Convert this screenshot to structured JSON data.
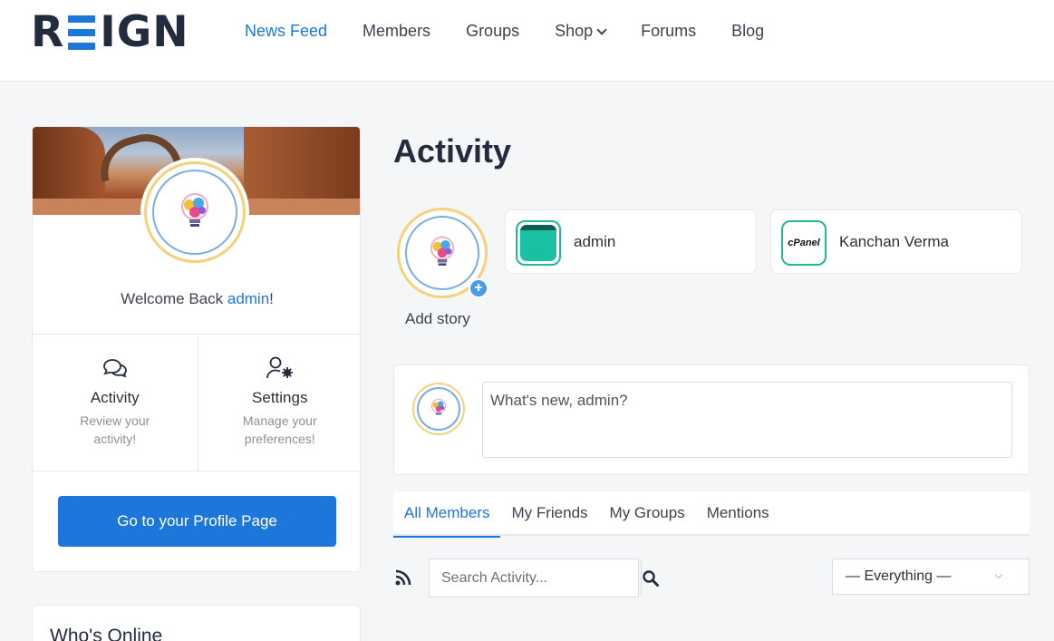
{
  "header": {
    "logo": {
      "left": "R",
      "right": "IGN"
    },
    "nav": [
      {
        "label": "News Feed",
        "active": true
      },
      {
        "label": "Members"
      },
      {
        "label": "Groups"
      },
      {
        "label": "Shop",
        "dropdown": true
      },
      {
        "label": "Forums"
      },
      {
        "label": "Blog"
      }
    ]
  },
  "profile_card": {
    "welcome_prefix": "Welcome Back ",
    "username": "admin",
    "welcome_suffix": "!",
    "shortcuts": [
      {
        "title": "Activity",
        "desc": "Review your activity!",
        "icon": "chat-bubbles-icon"
      },
      {
        "title": "Settings",
        "desc": "Manage your preferences!",
        "icon": "user-gear-icon"
      }
    ],
    "profile_button": "Go to your Profile Page"
  },
  "whos_online": {
    "title": "Who's Online"
  },
  "main": {
    "title": "Activity",
    "add_story_label": "Add story",
    "stories": [
      {
        "name": "admin"
      },
      {
        "name": "Kanchan Verma",
        "thumb_text": "cPanel"
      }
    ],
    "post": {
      "placeholder": "What's new, admin?"
    },
    "tabs": [
      {
        "label": "All Members",
        "active": true
      },
      {
        "label": "My Friends"
      },
      {
        "label": "My Groups"
      },
      {
        "label": "Mentions"
      }
    ],
    "search": {
      "placeholder": "Search Activity..."
    },
    "filter": {
      "selected": "— Everything —"
    }
  },
  "colors": {
    "accent": "#1d76da",
    "text_dark": "#232b3e",
    "story_teal": "#19c0a1"
  }
}
